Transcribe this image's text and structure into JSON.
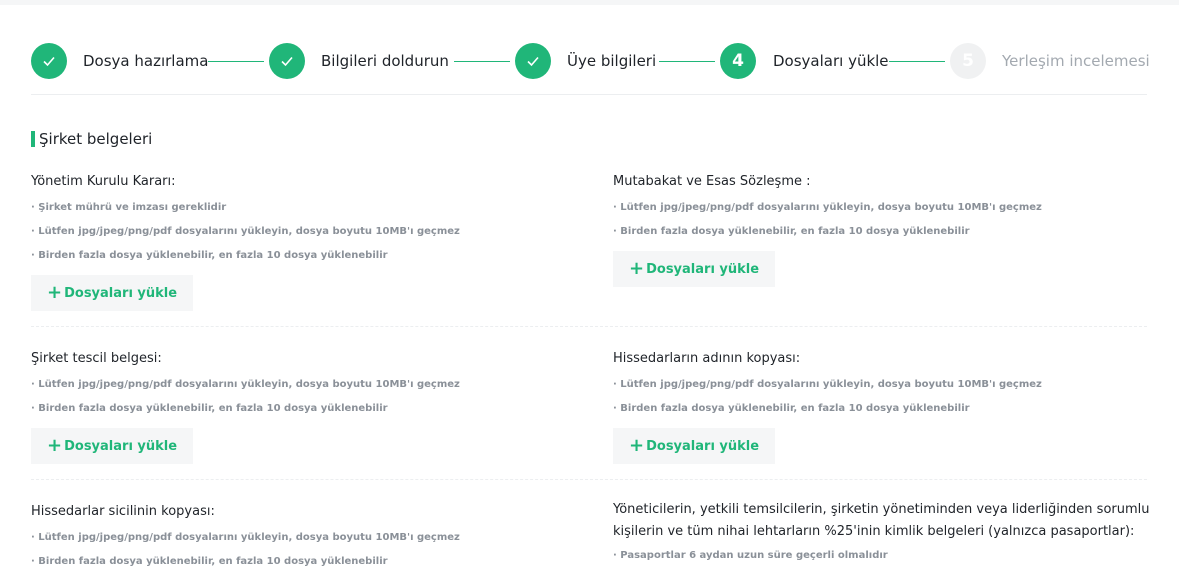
{
  "steps": [
    {
      "label": "Dosya hazırlama",
      "state": "done",
      "icon": "check-icon"
    },
    {
      "label": "Bilgileri doldurun",
      "state": "done",
      "icon": "check-icon"
    },
    {
      "label": "Üye bilgileri",
      "state": "done",
      "icon": "check-icon"
    },
    {
      "label": "Dosyaları yükle",
      "state": "active",
      "number": "4"
    },
    {
      "label": "Yerleşim incelemesi",
      "state": "todo",
      "number": "5"
    }
  ],
  "section": {
    "title": "Şirket belgeleri"
  },
  "upload_label": "Dosyaları yükle",
  "items": [
    {
      "title": "Yönetim Kurulu Kararı:",
      "hints": [
        "· Şirket mührü ve imzası gereklidir",
        "· Lütfen jpg/jpeg/png/pdf dosyalarını yükleyin, dosya boyutu 10MB'ı geçmez",
        "· Birden fazla dosya yüklenebilir, en fazla 10 dosya yüklenebilir"
      ]
    },
    {
      "title": "Mutabakat ve Esas Sözleşme :",
      "hints": [
        "· Lütfen jpg/jpeg/png/pdf dosyalarını yükleyin, dosya boyutu 10MB'ı geçmez",
        "· Birden fazla dosya yüklenebilir, en fazla 10 dosya yüklenebilir"
      ]
    },
    {
      "title": "Şirket tescil belgesi:",
      "hints": [
        "· Lütfen jpg/jpeg/png/pdf dosyalarını yükleyin, dosya boyutu 10MB'ı geçmez",
        "· Birden fazla dosya yüklenebilir, en fazla 10 dosya yüklenebilir"
      ]
    },
    {
      "title": "Hissedarların adının kopyası:",
      "hints": [
        "· Lütfen jpg/jpeg/png/pdf dosyalarını yükleyin, dosya boyutu 10MB'ı geçmez",
        "· Birden fazla dosya yüklenebilir, en fazla 10 dosya yüklenebilir"
      ]
    },
    {
      "title": "Hissedarlar sicilinin kopyası:",
      "hints": [
        "· Lütfen jpg/jpeg/png/pdf dosyalarını yükleyin, dosya boyutu 10MB'ı geçmez",
        "· Birden fazla dosya yüklenebilir, en fazla 10 dosya yüklenebilir"
      ]
    },
    {
      "title": "Yöneticilerin, yetkili temsilcilerin, şirketin yönetiminden veya liderliğinden sorumlu kişilerin ve tüm nihai lehtarların %25'inin kimlik belgeleri (yalnızca pasaportlar):",
      "hints": [
        "· Pasaportlar 6 aydan uzun süre geçerli olmalıdır"
      ]
    }
  ],
  "colors": {
    "accent": "#20b679",
    "hint": "#8a9098",
    "inactive": "#a3a9b0"
  }
}
